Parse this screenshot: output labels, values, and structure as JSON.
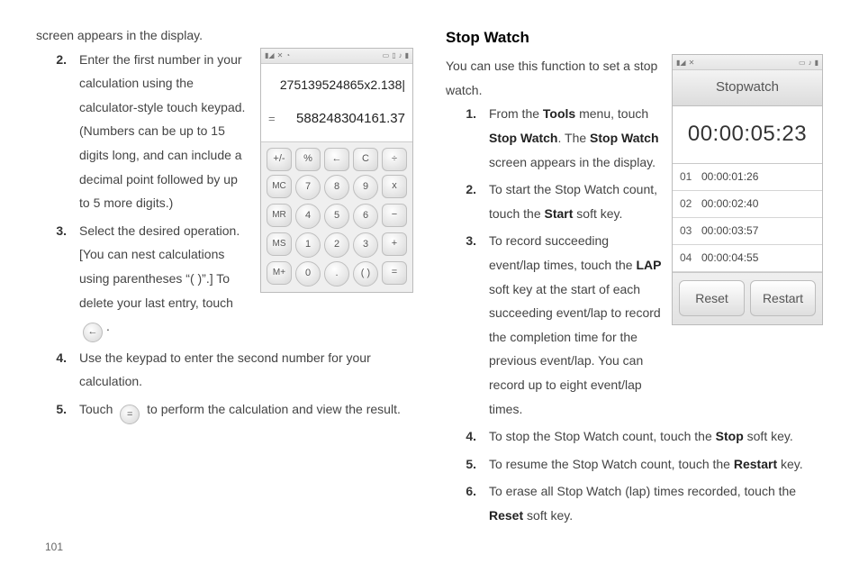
{
  "page_number": "101",
  "left": {
    "intro_tail": "screen appears in the display.",
    "steps": [
      {
        "n": "2.",
        "text": "Enter the first number in your calculation using the calculator-style touch keypad. (Numbers can be up to 15 digits long, and can include a decimal point followed by up to 5 more digits.)"
      },
      {
        "n": "3.",
        "pre": "Select the desired operation. [You can nest calculations using parentheses “( )”.] To delete your last entry, touch ",
        "icon": "←",
        "post": "."
      },
      {
        "n": "4.",
        "text": "Use the keypad to enter the second number for your calculation."
      },
      {
        "n": "5.",
        "pre": "Touch ",
        "icon": "=",
        "post": " to perform the calculation and view the result."
      }
    ],
    "calc": {
      "expression": "275139524865x2.138|",
      "eq_label": "=",
      "result": "588248304161.37",
      "keys_row1": [
        "+/-",
        "%",
        "←",
        "C",
        "÷"
      ],
      "keys_rows": [
        [
          "MC",
          "7",
          "8",
          "9",
          "x"
        ],
        [
          "MR",
          "4",
          "5",
          "6",
          "−"
        ],
        [
          "MS",
          "1",
          "2",
          "3",
          "+"
        ],
        [
          "M+",
          "0",
          ".",
          "( )",
          "="
        ]
      ]
    }
  },
  "right": {
    "heading": "Stop Watch",
    "intro": "You can use this function to set a stop watch.",
    "steps": [
      {
        "n": "1.",
        "parts": [
          "From the ",
          {
            "b": "Tools"
          },
          " menu, touch ",
          {
            "b": "Stop Watch"
          },
          ". The ",
          {
            "b": "Stop Watch"
          },
          " screen appears in the display."
        ]
      },
      {
        "n": "2.",
        "parts": [
          "To start the Stop Watch count, touch the ",
          {
            "b": "Start"
          },
          " soft key."
        ]
      },
      {
        "n": "3.",
        "parts": [
          "To record succeeding event/lap times, touch the ",
          {
            "b": "LAP"
          },
          " soft key at the start of each succeeding event/lap to record the completion time for the previous event/lap. You can record up to eight event/lap times."
        ]
      },
      {
        "n": "4.",
        "parts": [
          "To stop the Stop Watch count, touch the ",
          {
            "b": "Stop"
          },
          " soft key."
        ]
      },
      {
        "n": "5.",
        "parts": [
          "To resume the Stop Watch count, touch the ",
          {
            "b": "Restart"
          },
          " key."
        ]
      },
      {
        "n": "6.",
        "parts": [
          "To erase all Stop Watch (lap) times recorded, touch the ",
          {
            "b": "Reset"
          },
          " soft key."
        ]
      }
    ],
    "sw": {
      "title": "Stopwatch",
      "timer": "00:00:05:23",
      "laps": [
        {
          "n": "01",
          "t": "00:00:01:26"
        },
        {
          "n": "02",
          "t": "00:00:02:40"
        },
        {
          "n": "03",
          "t": "00:00:03:57"
        },
        {
          "n": "04",
          "t": "00:00:04:55"
        }
      ],
      "softkeys": [
        "Reset",
        "Restart"
      ]
    }
  }
}
